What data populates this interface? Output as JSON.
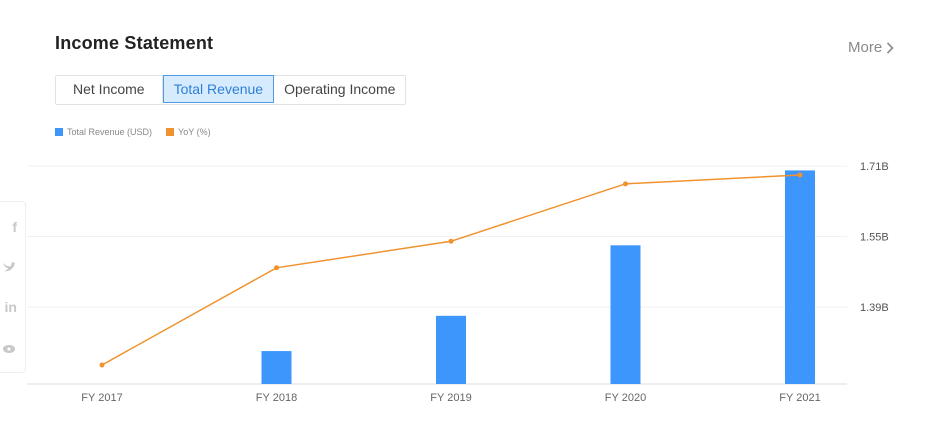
{
  "header": {
    "title": "Income Statement",
    "more_label": "More"
  },
  "tabs": [
    {
      "label": "Net Income",
      "active": false
    },
    {
      "label": "Total Revenue",
      "active": true
    },
    {
      "label": "Operating Income",
      "active": false
    }
  ],
  "social": {
    "icons": [
      "facebook-icon",
      "twitter-icon",
      "linkedin-icon",
      "weibo-icon"
    ]
  },
  "colors": {
    "bar": "#3d96fb",
    "line": "#f0922e",
    "accent": "#2e7fd6"
  },
  "chart_data": {
    "type": "bar",
    "categories": [
      "FY 2017",
      "FY 2018",
      "FY 2019",
      "FY 2020",
      "FY 2021"
    ],
    "series": [
      {
        "name": "Total Revenue (USD)",
        "type": "bar",
        "axis": "right",
        "values": [
          1.2,
          1.29,
          1.37,
          1.53,
          1.7
        ]
      },
      {
        "name": "YoY (%)",
        "type": "line",
        "axis": "hidden",
        "values": [
          5,
          27,
          33,
          46,
          48
        ]
      }
    ],
    "y_right": {
      "ticks": [
        1.39,
        1.55,
        1.71
      ],
      "tick_labels": [
        "1.39B",
        "1.55B",
        "1.71B"
      ]
    },
    "legend": "top-left",
    "grid": true
  }
}
